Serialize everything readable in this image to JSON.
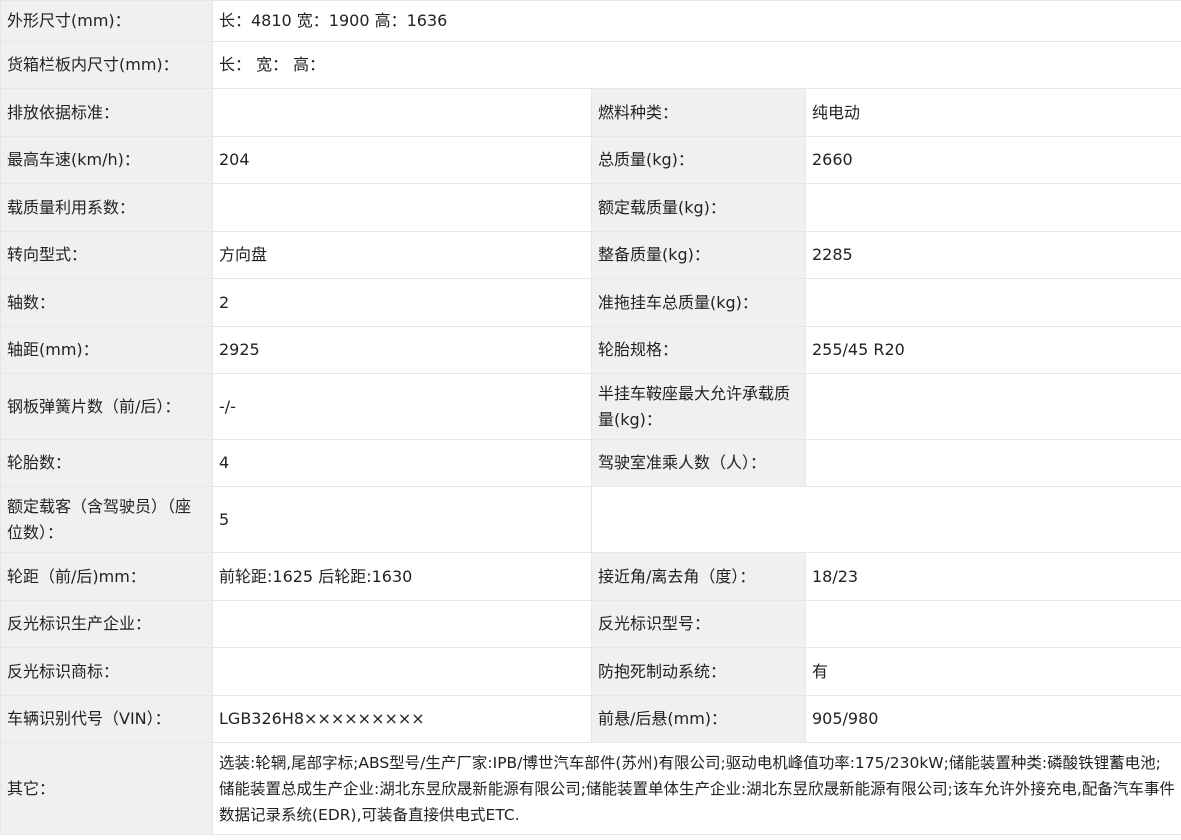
{
  "rows": [
    {
      "label": "外形尺寸(mm)：",
      "value": "长：4810 宽：1900 高：1636"
    },
    {
      "label": "货箱栏板内尺寸(mm)：",
      "value": "长：  宽：  高："
    },
    {
      "label": "排放依据标准：",
      "value": "",
      "label2": "燃料种类：",
      "value2": "纯电动"
    },
    {
      "label": "最高车速(km/h)：",
      "value": "204",
      "label2": "总质量(kg)：",
      "value2": "2660"
    },
    {
      "label": "载质量利用系数：",
      "value": "",
      "label2": "额定载质量(kg)：",
      "value2": ""
    },
    {
      "label": "转向型式：",
      "value": "方向盘",
      "label2": "整备质量(kg)：",
      "value2": "2285"
    },
    {
      "label": "轴数：",
      "value": "2",
      "label2": "准拖挂车总质量(kg)：",
      "value2": ""
    },
    {
      "label": "轴距(mm)：",
      "value": "2925",
      "label2": "轮胎规格：",
      "value2": "255/45 R20"
    },
    {
      "label": "钢板弹簧片数（前/后）：",
      "value": "-/-",
      "label2": "半挂车鞍座最大允许承载质量(kg)：",
      "value2": ""
    },
    {
      "label": "轮胎数：",
      "value": "4",
      "label2": "驾驶室准乘人数（人）：",
      "value2": ""
    },
    {
      "label": "额定载客（含驾驶员）（座位数）：",
      "value": "5"
    },
    {
      "label": "轮距（前/后)mm：",
      "value": "前轮距:1625 后轮距:1630",
      "label2": "接近角/离去角（度）：",
      "value2": "18/23"
    },
    {
      "label": "反光标识生产企业：",
      "value": "",
      "label2": "反光标识型号：",
      "value2": ""
    },
    {
      "label": "反光标识商标：",
      "value": "",
      "label2": "防抱死制动系统：",
      "value2": "有"
    },
    {
      "label": "车辆识别代号（VIN）：",
      "value": "LGB326H8×××××××××",
      "label2": "前悬/后悬(mm)：",
      "value2": "905/980"
    },
    {
      "label": "其它：",
      "value": "选装:轮辋,尾部字标;ABS型号/生产厂家:IPB/博世汽车部件(苏州)有限公司;驱动电机峰值功率:175/230kW;储能装置种类:磷酸铁锂蓄电池;储能装置总成生产企业:湖北东昱欣晟新能源有限公司;储能装置单体生产企业:湖北东昱欣晟新能源有限公司;该车允许外接充电,配备汽车事件数据记录系统(EDR),可装备直接供电式ETC."
    }
  ]
}
